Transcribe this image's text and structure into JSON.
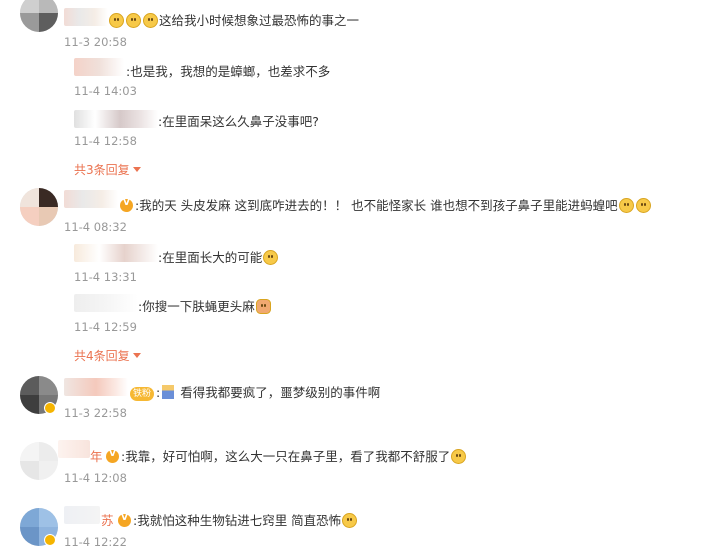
{
  "comments": [
    {
      "id": "c0",
      "text": "这给我小时候想象过最恐怖的事之一",
      "time": "11-3 20:58",
      "replies": [
        {
          "text": ":也是我，我想的是蟑螂，也差求不多",
          "time": "11-4 14:03"
        },
        {
          "text": ":在里面呆这么久鼻子没事吧?",
          "time": "11-4 12:58"
        }
      ],
      "more": "共3条回复"
    },
    {
      "id": "c1",
      "text": ":我的天 头皮发麻 这到底咋进去的！！ 也不能怪家长 谁也想不到孩子鼻子里能进蚂蝗吧",
      "time": "11-4 08:32",
      "replies": [
        {
          "text": ":在里面长大的可能",
          "time": "11-4 13:31"
        },
        {
          "text": ":你搜一下肤蝇更头麻",
          "time": "11-4 12:59"
        }
      ],
      "more": "共4条回复"
    },
    {
      "id": "c2",
      "badge": "铁粉",
      "text": "看得我都要疯了，噩梦级别的事件啊",
      "time": "11-3 22:58"
    },
    {
      "id": "c3",
      "name_fragment": "年",
      "text": ":我靠，好可怕啊，这么大一只在鼻子里，看了我都不舒服了",
      "time": "11-4 12:08"
    },
    {
      "id": "c4",
      "name_fragment": "苏",
      "text": ":我就怕这种生物钻进七窍里 简直恐怖",
      "time": "11-4 12:22"
    }
  ],
  "colors": {
    "accent": "#eb7350",
    "time": "#999999",
    "text": "#333333"
  }
}
